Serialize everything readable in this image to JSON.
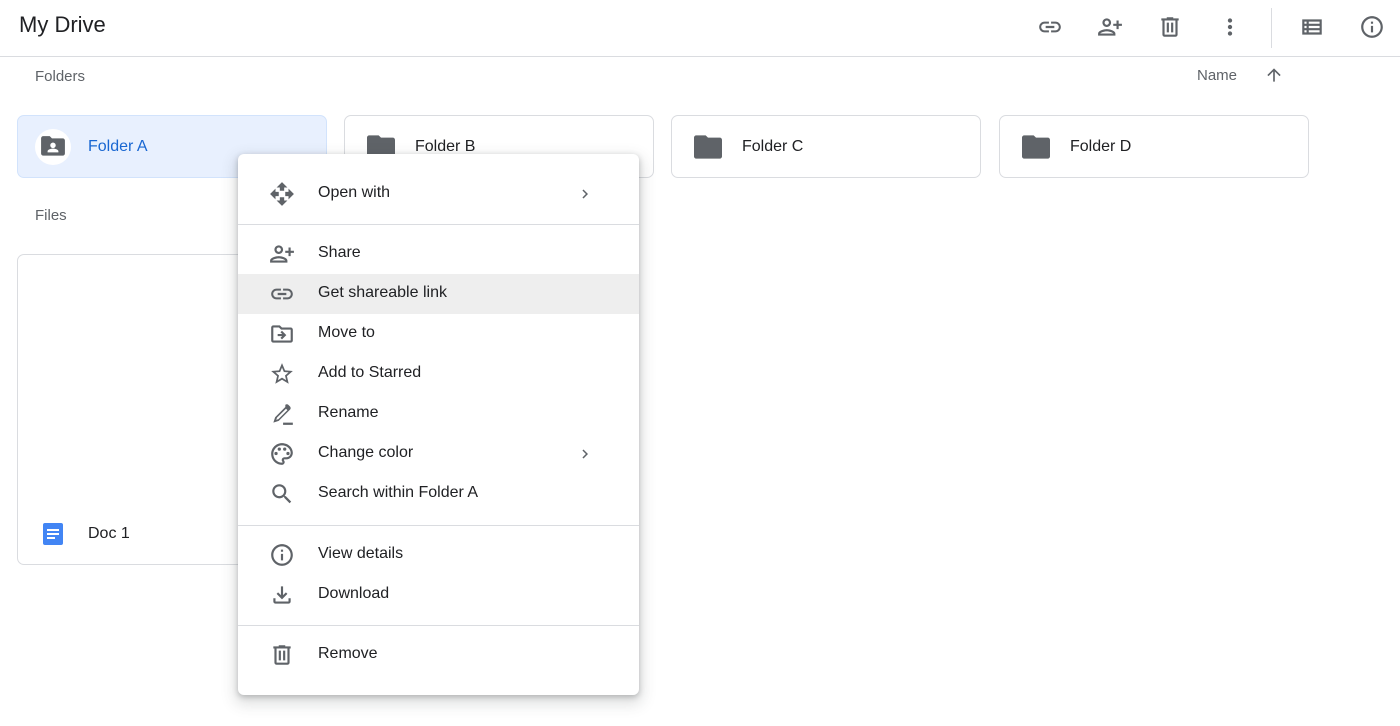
{
  "header": {
    "title": "My Drive",
    "actions": [
      "link-icon",
      "person-add-icon",
      "trash-icon",
      "more-vert-icon",
      "list-view-icon",
      "info-icon"
    ]
  },
  "sections": {
    "folders_label": "Folders",
    "files_label": "Files",
    "sort_label": "Name",
    "sort_direction": "ascending"
  },
  "folders": [
    {
      "name": "Folder A",
      "selected": true,
      "shared": true
    },
    {
      "name": "Folder B",
      "selected": false,
      "shared": false
    },
    {
      "name": "Folder C",
      "selected": false,
      "shared": false
    },
    {
      "name": "Folder D",
      "selected": false,
      "shared": false
    }
  ],
  "files": [
    {
      "name": "Doc 1",
      "type": "document",
      "icon_color": "#4285f4"
    }
  ],
  "context_menu": {
    "items": [
      {
        "label": "Open with",
        "icon": "open-with-icon",
        "submenu": true
      },
      {
        "label": "Share",
        "icon": "person-add-icon"
      },
      {
        "label": "Get shareable link",
        "icon": "link-icon",
        "highlighted": true
      },
      {
        "label": "Move to",
        "icon": "move-to-icon"
      },
      {
        "label": "Add to Starred",
        "icon": "star-icon"
      },
      {
        "label": "Rename",
        "icon": "rename-icon"
      },
      {
        "label": "Change color",
        "icon": "palette-icon",
        "submenu": true
      },
      {
        "label": "Search within Folder A",
        "icon": "search-icon"
      },
      {
        "label": "View details",
        "icon": "info-icon"
      },
      {
        "label": "Download",
        "icon": "download-icon"
      },
      {
        "label": "Remove",
        "icon": "trash-icon"
      }
    ]
  },
  "colors": {
    "selected_bg": "#e8f0fe",
    "selected_text": "#1967d2",
    "icon_gray": "#5f6368",
    "hover_bg": "#eeeeee",
    "doc_blue": "#4285f4"
  }
}
